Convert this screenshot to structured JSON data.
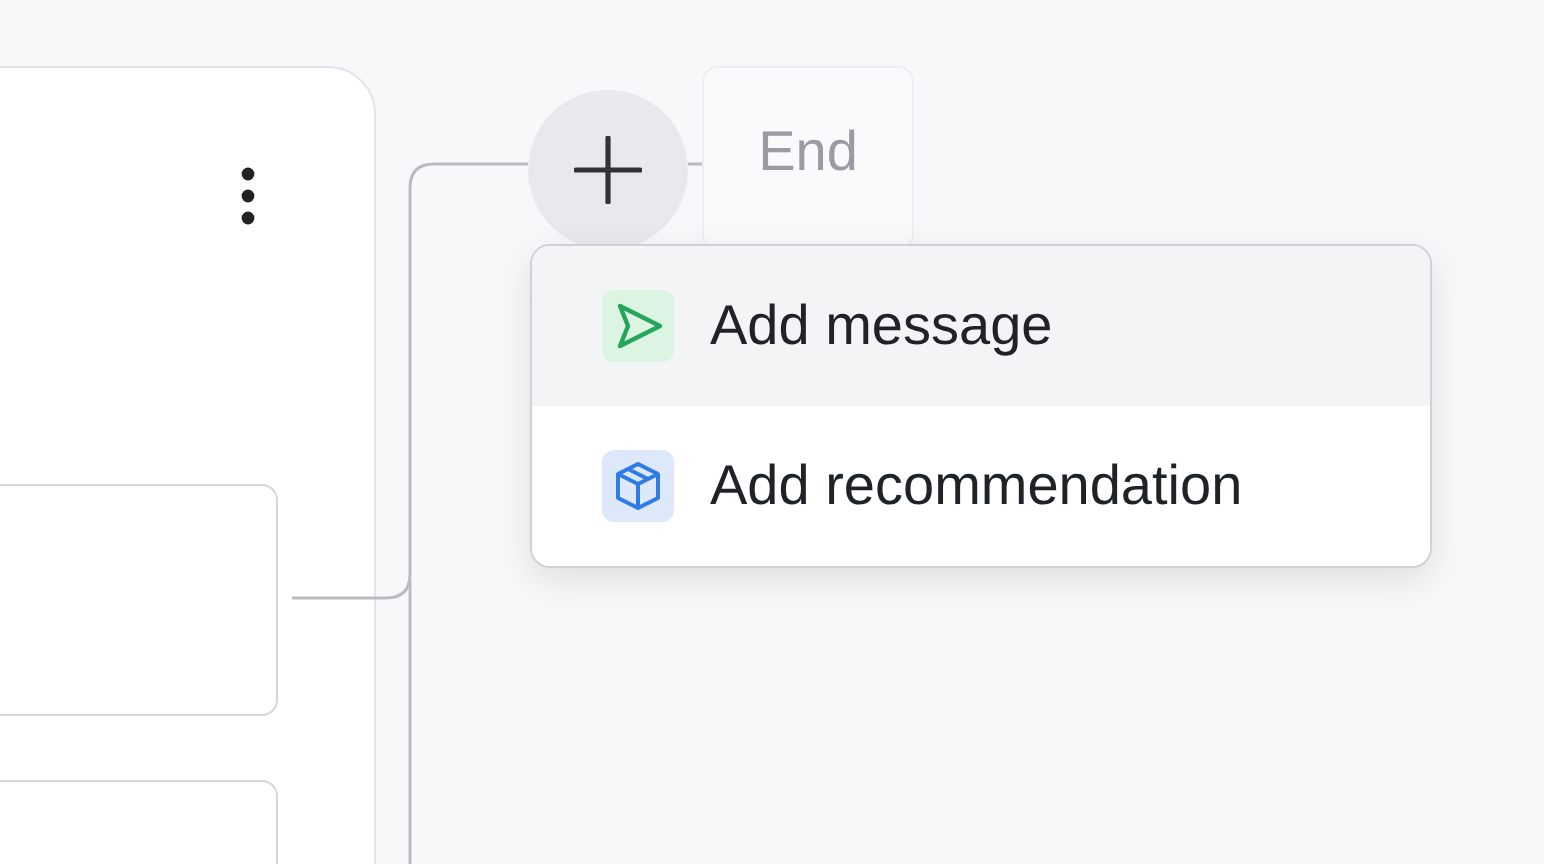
{
  "end_node": {
    "label": "End"
  },
  "menu": {
    "items": [
      {
        "label": "Add message",
        "kind": "message",
        "selected": true
      },
      {
        "label": "Add recommendation",
        "kind": "recommendation",
        "selected": false
      }
    ]
  }
}
